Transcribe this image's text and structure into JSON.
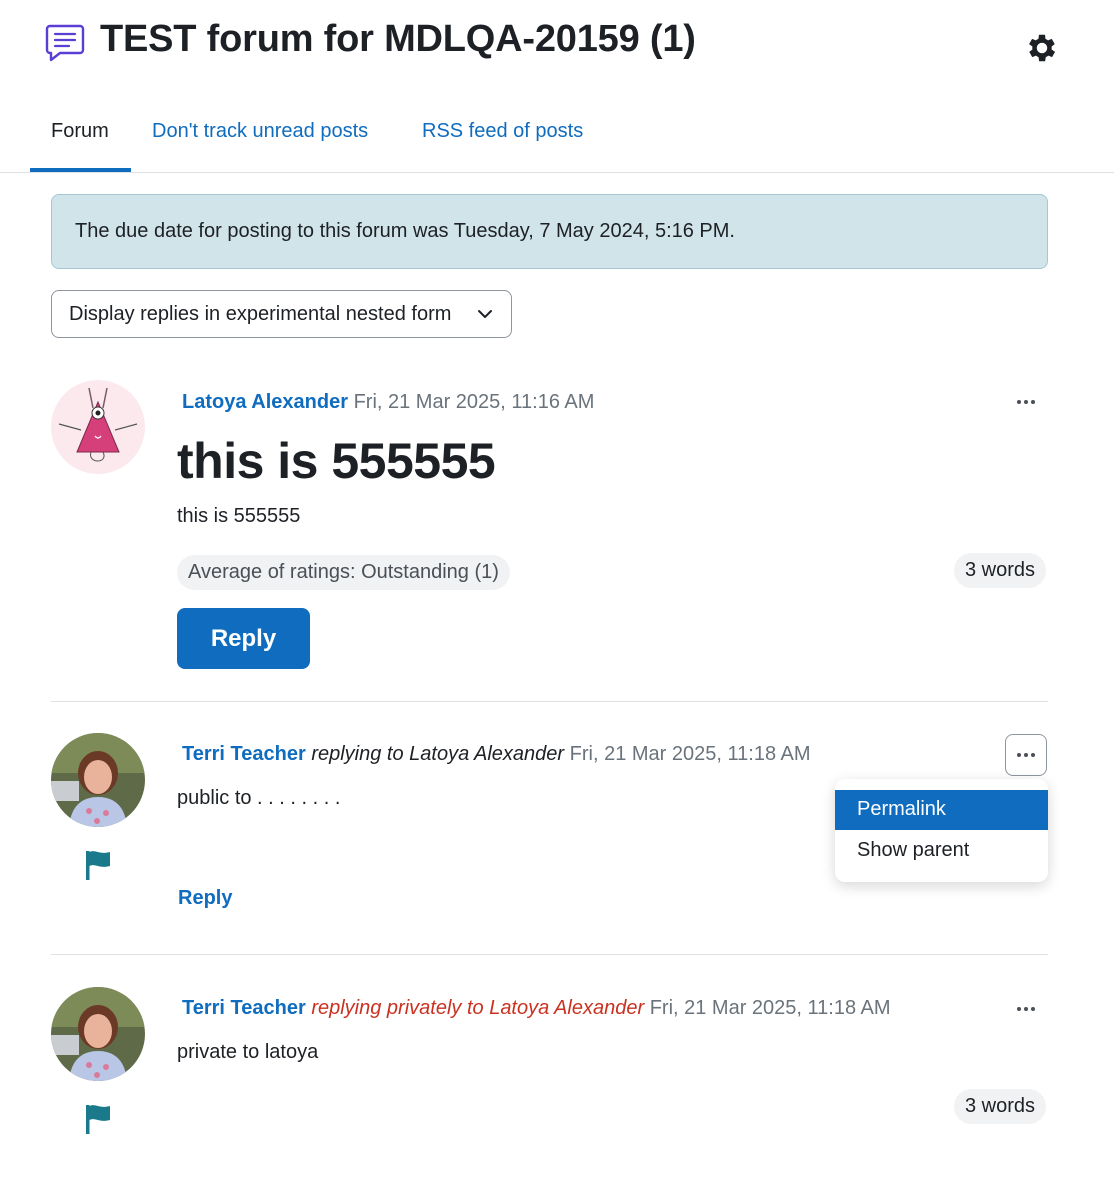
{
  "page": {
    "title": "TEST forum for MDLQA-20159 (1)"
  },
  "tabs": [
    {
      "label": "Forum",
      "active": true
    },
    {
      "label": "Don't track unread posts",
      "active": false
    },
    {
      "label": "RSS feed of posts",
      "active": false
    }
  ],
  "alert": {
    "text": "The due date for posting to this forum was Tuesday, 7 May 2024, 5:16 PM."
  },
  "display_mode": {
    "selected": "Display replies in experimental nested form"
  },
  "posts": [
    {
      "author": "Latoya Alexander",
      "date": "Fri, 21 Mar 2025, 11:16 AM",
      "subject": "this is 555555",
      "body": "this is 555555",
      "rating": "Average of ratings: Outstanding (1)",
      "word_count": "3 words",
      "reply_label": "Reply"
    },
    {
      "author": "Terri Teacher",
      "reply_text": "replying to Latoya Alexander",
      "date": "Fri, 21 Mar 2025, 11:18 AM",
      "body": "public to . . . . . . . .",
      "reply_label": "Reply"
    },
    {
      "author": "Terri Teacher",
      "reply_text": "replying privately to Latoya Alexander",
      "date": "Fri, 21 Mar 2025, 11:18 AM",
      "body": "private to latoya",
      "word_count": "3 words"
    }
  ],
  "actions_menu": {
    "items": [
      "Permalink",
      "Show parent"
    ],
    "active_item": "Permalink"
  },
  "colors": {
    "link": "#0f6cbf",
    "primary_button": "#0f6cbf",
    "alert_bg": "#d1e4e9",
    "private_reply": "#ca3120",
    "flag": "#1a7a8c",
    "forum_icon": "#5b3fd4"
  }
}
